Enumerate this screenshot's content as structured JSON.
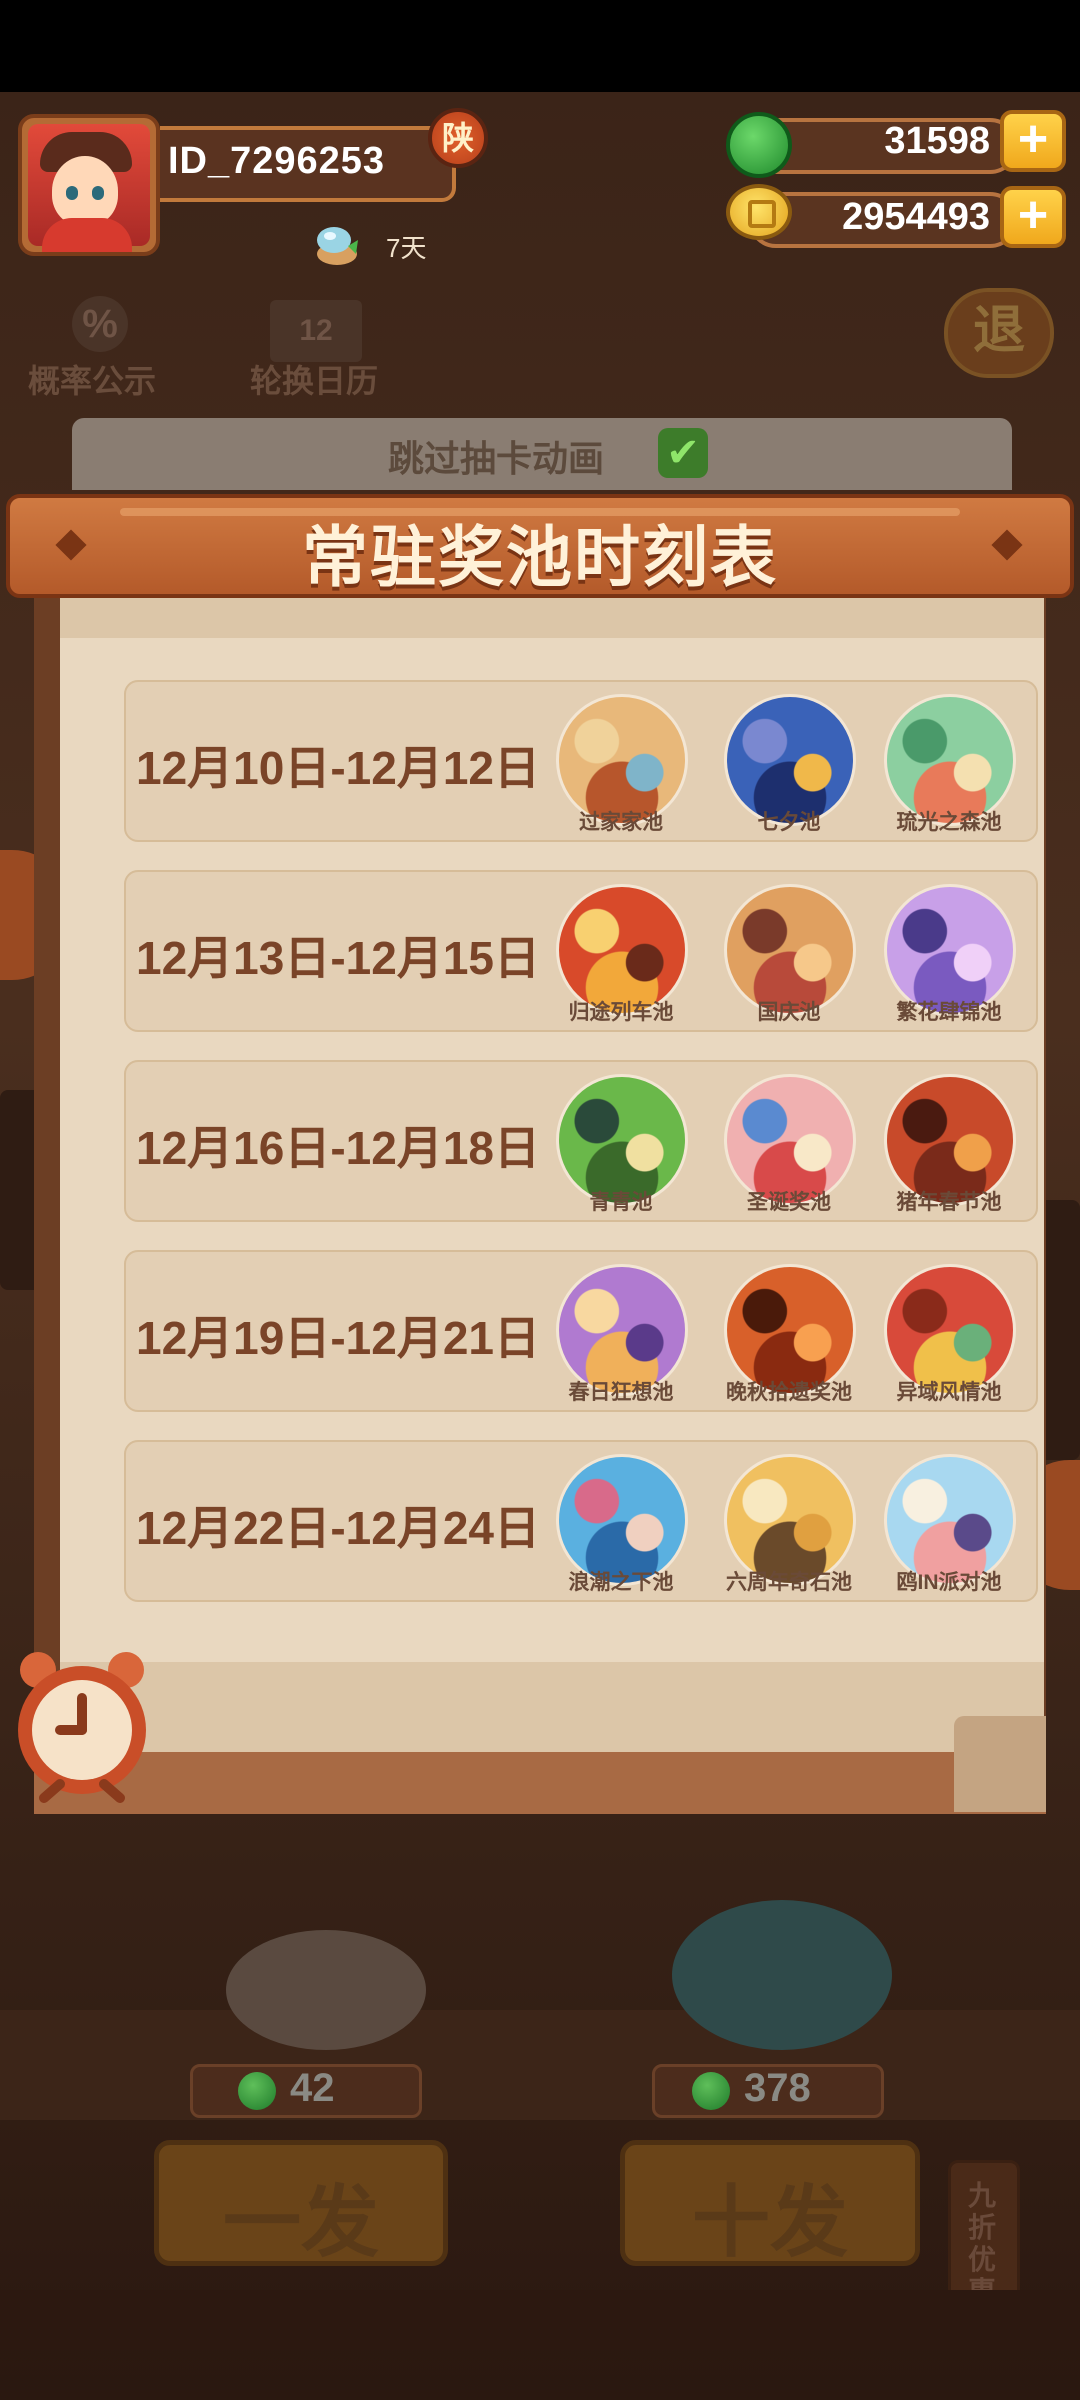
{
  "player": {
    "id": "ID_7296253",
    "vip_badge": "陕",
    "days": "7天"
  },
  "currency": {
    "gems": "31598",
    "coins": "2954493",
    "plus": "+"
  },
  "side_menu": {
    "probability": "概率公示",
    "probability_icon": "%",
    "calendar": "轮换日历",
    "calendar_icon": "12",
    "exit": "退"
  },
  "skip_animation": {
    "label": "跳过抽卡动画",
    "checked": true,
    "check_glyph": "✔"
  },
  "modal": {
    "title": "常驻奖池时刻表",
    "rows": [
      {
        "date": "12月10日-12月12日",
        "pools": [
          "过家家池",
          "七夕池",
          "琉光之森池"
        ]
      },
      {
        "date": "12月13日-12月15日",
        "pools": [
          "归途列车池",
          "国庆池",
          "繁花肆锦池"
        ]
      },
      {
        "date": "12月16日-12月18日",
        "pools": [
          "青青池",
          "圣诞奖池",
          "猪年春节池"
        ]
      },
      {
        "date": "12月19日-12月21日",
        "pools": [
          "春日狂想池",
          "晚秋拾遗奖池",
          "异域风情池"
        ]
      },
      {
        "date": "12月22日-12月24日",
        "pools": [
          "浪潮之下池",
          "六周年奇石池",
          "鸥IN派对池"
        ]
      }
    ]
  },
  "draw": {
    "single": {
      "label": "一发",
      "cost": "42"
    },
    "ten": {
      "label": "十发",
      "cost": "378"
    },
    "discount": "九折优惠"
  },
  "colors": {
    "banner": "#c0652f",
    "paper": "#e9d8c0",
    "date_text": "#7a4428"
  }
}
